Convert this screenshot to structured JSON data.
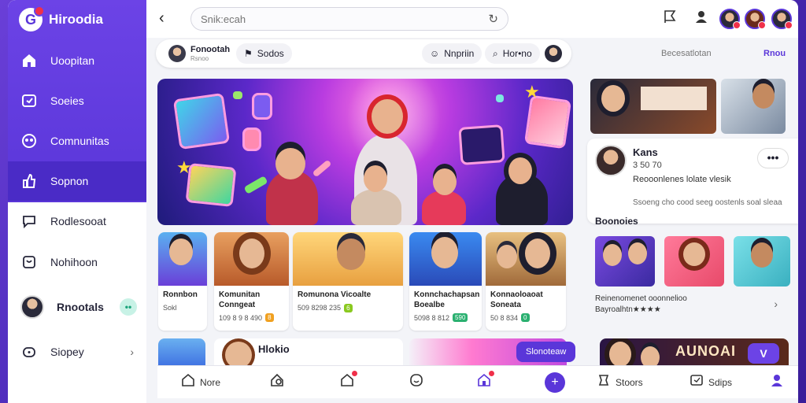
{
  "app": {
    "name": "Hiroodia"
  },
  "sidebar": {
    "items": [
      {
        "label": "Uoopitan",
        "icon": "home-icon"
      },
      {
        "label": "Soeies",
        "icon": "series-icon"
      },
      {
        "label": "Comnunitas",
        "icon": "community-icon"
      },
      {
        "label": "Sopnon",
        "icon": "support-icon"
      },
      {
        "label": "Rodlesooat",
        "icon": "chat-icon"
      },
      {
        "label": "Nohihoon",
        "icon": "notification-icon"
      },
      {
        "label": "Rnootals",
        "icon": "profile-avatar"
      },
      {
        "label": "Siopey",
        "icon": "store-icon"
      }
    ],
    "badge": "••"
  },
  "topbar": {
    "search_placeholder": "Snik:ecah"
  },
  "filterbar": {
    "user_name": "Fonootah",
    "user_sub": "Rsnoo",
    "series_label": "Sodos",
    "hot_label": "Nnpriin",
    "more_label": "Hor•no"
  },
  "right_links": {
    "recent": "Becesatlotan",
    "all": "Rnou"
  },
  "cards": [
    {
      "title": "Ronnbon",
      "meta": "Sokl",
      "tag": ""
    },
    {
      "title": "Komunitan Conngeat",
      "meta": "109 8 9 8 490",
      "tag": "8"
    },
    {
      "title": "Romunona Vicoalte",
      "meta": "509 8298 235",
      "tag": "6"
    },
    {
      "title": "Konnchachapsan Boealbe",
      "meta": "5098 8 812",
      "tag": "590"
    },
    {
      "title": "Konnaoloaoat Soneata",
      "meta": "50 8 834",
      "tag": "0"
    }
  ],
  "lower": {
    "title": "Hlokio",
    "watch_label": "Slonoteaw"
  },
  "profile": {
    "name": "Kans",
    "stat": "3 50 70",
    "desc": "Reooonlenes lolate vlesik",
    "meta": "Ssoeng cho cood seeg oostenls soal sleaa",
    "more": "•••"
  },
  "right_section": {
    "title": "Boonoies",
    "line1": "Reinenomenet ooonnelioo",
    "line2": "Bayroalhtn★★★★"
  },
  "promo": {
    "text": "AUNOAI",
    "btn": "V"
  },
  "bottomnav": [
    {
      "label": "Nore"
    },
    {
      "label": ""
    },
    {
      "label": ""
    },
    {
      "label": ""
    },
    {
      "label": ""
    },
    {
      "label": ""
    },
    {
      "label": "Stoors"
    },
    {
      "label": "Sdips"
    },
    {
      "label": ""
    }
  ],
  "colors": {
    "accent": "#5a36d9",
    "sidebar_top": "#6c43e6",
    "active": "#4a2bc6",
    "alert": "#f0304a"
  }
}
